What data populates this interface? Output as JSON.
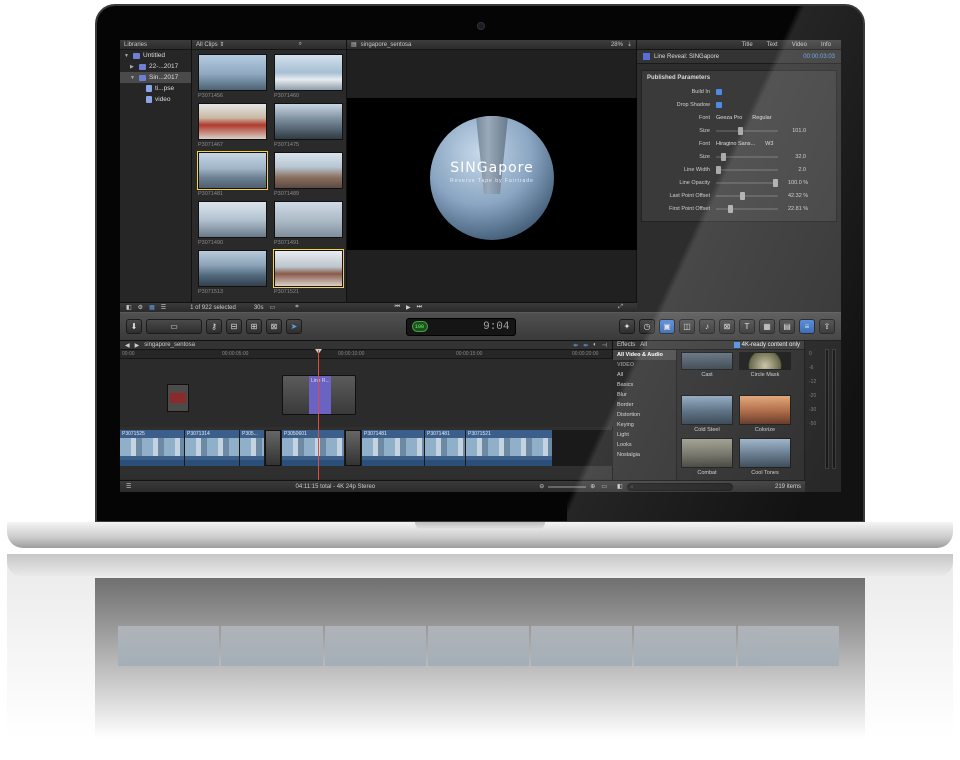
{
  "browser": {
    "library_header": "Libraries",
    "clips_filter": "All Clips ⇕",
    "library_rows": [
      {
        "label": "Untitled"
      },
      {
        "label": "22-...2017"
      },
      {
        "label": "Sin...2017"
      },
      {
        "label": "ti...pse"
      },
      {
        "label": "video"
      }
    ],
    "clips": [
      {
        "name": "P3071456"
      },
      {
        "name": "P3071460"
      },
      {
        "name": "P3071467"
      },
      {
        "name": "P3071475"
      },
      {
        "name": "P3071481"
      },
      {
        "name": "P3071489"
      },
      {
        "name": "P3071490"
      },
      {
        "name": "P3071491"
      },
      {
        "name": "P3071513"
      },
      {
        "name": "P3071521"
      }
    ],
    "selection_status": "1 of 922 selected",
    "duration_label": "30s"
  },
  "viewer": {
    "title": "singapore_sentosa",
    "zoom": "28%",
    "overlay_title": "SINGapore",
    "overlay_subtitle": "Reverse Tape by Fairtrade"
  },
  "inspector": {
    "tabs": [
      "Title",
      "Text",
      "Video",
      "Info"
    ],
    "title": "Line Reveal: SINGapore",
    "timecode": "00:00:03:03",
    "section": "Published Parameters",
    "build_in": "Build In",
    "drop_shadow": "Drop Shadow",
    "font1": {
      "label": "Font",
      "family": "Geeza Pro",
      "style": "Regular"
    },
    "size1": {
      "label": "Size",
      "value": "101.0"
    },
    "font2": {
      "label": "Font",
      "family": "Hiragino Sans...",
      "style": "W3"
    },
    "size2": {
      "label": "Size",
      "value": "32.0"
    },
    "line_width": {
      "label": "Line Width",
      "value": "2.0"
    },
    "line_opacity": {
      "label": "Line Opacity",
      "value": "100.0 %"
    },
    "last_point": {
      "label": "Last Point Offset",
      "value": "42.32 %"
    },
    "first_point": {
      "label": "First Point Offset",
      "value": "22.81 %"
    }
  },
  "toolbar": {
    "timecode": "9:04",
    "timecode_badge": "100"
  },
  "timeline": {
    "project": "singapore_sentosa",
    "ruler": [
      "00:00",
      "00:00:05:00",
      "00:00:10:00",
      "00:00:15:00",
      "00:00:20:00"
    ],
    "title_clip": "Line R...",
    "segments": [
      {
        "name": "P3071525"
      },
      {
        "name": "P3071314"
      },
      {
        "name": "P305..."
      },
      {
        "name": "P3050601"
      },
      {
        "name": "P3071481"
      },
      {
        "name": "P3071481"
      },
      {
        "name": "P3071521"
      }
    ],
    "total": "04:11:15 total - 4K 24p Stereo"
  },
  "effects": {
    "title": "Effects",
    "all": "All",
    "fourk_label": "4K-ready content only",
    "categories": [
      "All Video & Audio",
      "VIDEO",
      "All",
      "Basics",
      "Blur",
      "Border",
      "Distortion",
      "Keying",
      "Light",
      "Looks",
      "Nostalgia"
    ],
    "items": [
      {
        "name": "Cast"
      },
      {
        "name": "Circle Mask"
      },
      {
        "name": "Cold Steel"
      },
      {
        "name": "Colorize"
      },
      {
        "name": "Combat"
      },
      {
        "name": "Cool Tones"
      }
    ],
    "count": "219 items"
  },
  "meters": {
    "scale": [
      "0",
      "-6",
      "-12",
      "-20",
      "-30",
      "-50"
    ]
  },
  "colors": {
    "accent_blue": "#4b8de6",
    "title_clip_purple": "#6a63c4",
    "playhead": "#e24b3a",
    "timecode_green": "#3fa33f"
  }
}
